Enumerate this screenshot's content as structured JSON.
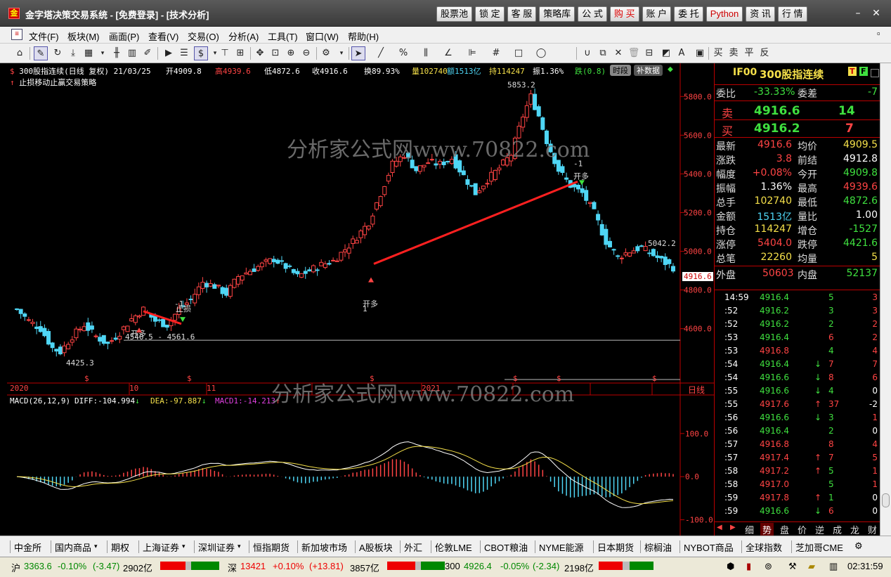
{
  "titlebar": {
    "title": "金字塔决策交易系统 - [免费登录] - [技术分析]",
    "buttons": [
      "股票池",
      "锁 定",
      "客 服",
      "策略库",
      "公 式",
      "购 买",
      "账 户",
      "委 托",
      "Python",
      "资 讯",
      "行 情"
    ]
  },
  "menu": [
    "文件(F)",
    "板块(M)",
    "画面(P)",
    "查看(V)",
    "交易(O)",
    "分析(A)",
    "工具(T)",
    "窗口(W)",
    "帮助(H)"
  ],
  "chart_header": {
    "symbol": "300股指连续(日线 复权) 21/03/25",
    "open": "开4909.8",
    "high": "高4939.6",
    "low": "低4872.6",
    "close": "收4916.6",
    "turnover": "换89.93%",
    "volume": "量102740",
    "amount": "额1513亿",
    "hold": "持114247",
    "amplitude": "振1.36%",
    "fall": "跌(0.8)",
    "btn_time": "时段",
    "btn_fill": "补数据",
    "strategy": "止损移动止赢交易策略"
  },
  "watermark": "分析家公式网www.70822.com",
  "chart_data": [
    {
      "type": "candlestick",
      "title": "300股指连续(日线 复权)",
      "ylim": [
        4330,
        5870
      ],
      "yticks": [
        4600,
        4800,
        5000,
        5200,
        5400,
        5600,
        5800
      ],
      "xticks": [
        "2020",
        "10",
        "11",
        "",
        "",
        "",
        "",
        "2021",
        ""
      ],
      "annotations": [
        "5853.2",
        "5042.2",
        "4425.3",
        "4540.5 - 4561.6",
        "开多",
        "止损",
        "止盈",
        "-1",
        "1"
      ],
      "last_price": "4916.6",
      "period_label": "日线"
    },
    {
      "type": "line",
      "title": "MACD(26,12,9)",
      "series": [
        {
          "name": "DIFF",
          "value": -104.994
        },
        {
          "name": "DEA",
          "value": -97.887
        },
        {
          "name": "MACD1",
          "value": -14.213
        }
      ],
      "yticks": [
        -100,
        0,
        100
      ]
    }
  ],
  "macd_header": {
    "title": "MACD(26,12,9)",
    "diff": "DIFF:-104.994",
    "dea": "DEA:-97.887",
    "macd": "MACD1:-14.213"
  },
  "quote": {
    "code": "IF00",
    "name": "300股指连续",
    "tag1": "T",
    "tag2": "F",
    "wb": "委比",
    "wb_val": "-33.33%",
    "wc": "委差",
    "wc_val": "-7",
    "sell": "卖",
    "sell_price": "4916.6",
    "sell_vol": "14",
    "buy": "买",
    "buy_price": "4916.2",
    "buy_vol": "7",
    "rows": [
      [
        "最新",
        "4916.6",
        "均价",
        "4909.5"
      ],
      [
        "涨跌",
        "3.8",
        "前结",
        "4912.8"
      ],
      [
        "幅度",
        "+0.08%",
        "今开",
        "4909.8"
      ],
      [
        "振幅",
        "1.36%",
        "最高",
        "4939.6"
      ],
      [
        "总手",
        "102740",
        "最低",
        "4872.6"
      ],
      [
        "金额",
        "1513亿",
        "量比",
        "1.00"
      ],
      [
        "持仓",
        "114247",
        "增仓",
        "-1527"
      ],
      [
        "涨停",
        "5404.0",
        "跌停",
        "4421.6"
      ],
      [
        "总笔",
        "22260",
        "均量",
        "5"
      ]
    ],
    "outer": "外盘",
    "outer_val": "50603",
    "inner": "内盘",
    "inner_val": "52137",
    "ticks": [
      [
        "14:59",
        "4916.4",
        "5",
        "3"
      ],
      [
        ":52",
        "4916.2",
        "3",
        "3"
      ],
      [
        ":52",
        "4916.2",
        "2",
        "2"
      ],
      [
        ":53",
        "4916.4",
        "6",
        "2"
      ],
      [
        ":53",
        "4916.8",
        "4",
        "4"
      ],
      [
        ":54",
        "4916.4",
        "7",
        "7"
      ],
      [
        ":54",
        "4916.6",
        "8",
        "6"
      ],
      [
        ":55",
        "4916.6",
        "4",
        "0"
      ],
      [
        ":55",
        "4917.6",
        "37",
        "-2"
      ],
      [
        ":56",
        "4916.6",
        "3",
        "1"
      ],
      [
        ":56",
        "4916.4",
        "2",
        "0"
      ],
      [
        ":57",
        "4916.8",
        "8",
        "4"
      ],
      [
        ":57",
        "4917.4",
        "7",
        "5"
      ],
      [
        ":58",
        "4917.2",
        "5",
        "1"
      ],
      [
        ":58",
        "4917.0",
        "5",
        "1"
      ],
      [
        ":59",
        "4917.8",
        "1",
        "0"
      ],
      [
        ":59",
        "4916.6",
        "6",
        "0"
      ]
    ],
    "tabs": [
      "细",
      "势",
      "盘",
      "价",
      "逆",
      "成",
      "龙",
      "财"
    ]
  },
  "bottom_tabs": [
    "中金所",
    "国内商品",
    "期权",
    "上海证券",
    "深圳证券",
    "恒指期货",
    "新加坡市场",
    "A股板块",
    "外汇",
    "伦敦LME",
    "CBOT粮油",
    "NYME能源",
    "日本期货",
    "棕榈油",
    "NYBOT商品",
    "全球指数",
    "芝加哥CME"
  ],
  "status": {
    "sh": "沪",
    "sh_val": "3363.6",
    "sh_chg": "-0.10%",
    "sh_diff": "(-3.47)",
    "sh_amt": "2902亿",
    "sz": "深",
    "sz_val": "13421",
    "sz_chg": "+0.10%",
    "sz_diff": "(+13.81)",
    "sz_amt": "3857亿",
    "hs": "300",
    "hs_val": "4926.4",
    "hs_chg": "-0.05%",
    "hs_diff": "(-2.34)",
    "hs_amt": "2198亿",
    "time": "02:31:59"
  }
}
